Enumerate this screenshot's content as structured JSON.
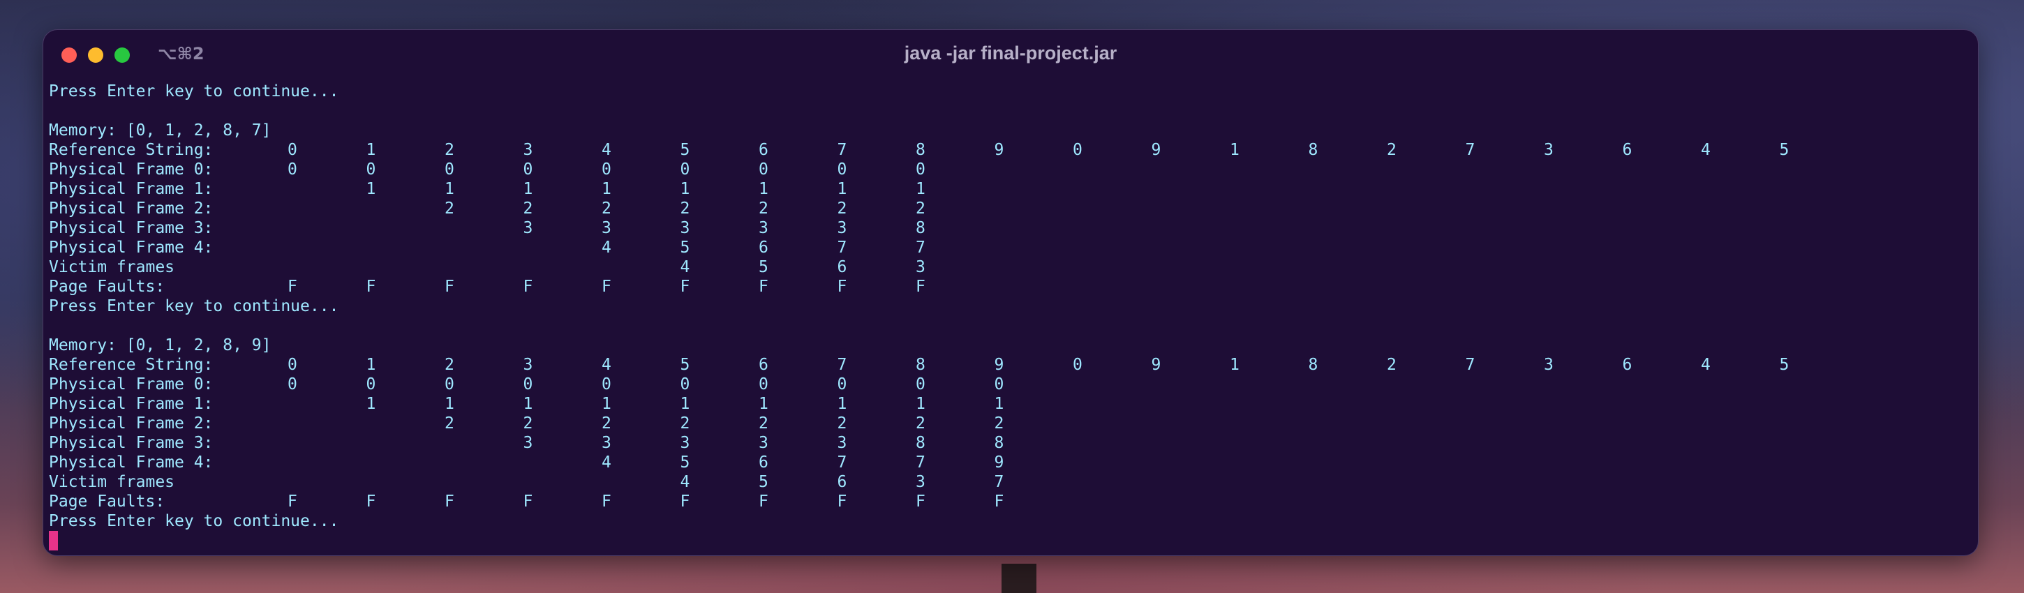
{
  "window": {
    "title": "java -jar final-project.jar",
    "shortcut": "⌥⌘2"
  },
  "colors": {
    "terminal_bg": "#1e0d36",
    "text": "#9fe8ff",
    "cursor": "#e6338a"
  },
  "terminal": {
    "lines": [
      "Press Enter key to continue...",
      "",
      "Memory: [0, 1, 2, 8, 7]",
      {
        "label": "Reference String:",
        "cells": [
          "0",
          "1",
          "2",
          "3",
          "4",
          "5",
          "6",
          "7",
          "8",
          "9",
          "0",
          "9",
          "1",
          "8",
          "2",
          "7",
          "3",
          "6",
          "4",
          "5"
        ]
      },
      {
        "label": "Physical Frame 0:",
        "cells": [
          "0",
          "0",
          "0",
          "0",
          "0",
          "0",
          "0",
          "0",
          "0"
        ]
      },
      {
        "label": "Physical Frame 1:",
        "cells": [
          "",
          "1",
          "1",
          "1",
          "1",
          "1",
          "1",
          "1",
          "1"
        ]
      },
      {
        "label": "Physical Frame 2:",
        "cells": [
          "",
          "",
          "2",
          "2",
          "2",
          "2",
          "2",
          "2",
          "2"
        ]
      },
      {
        "label": "Physical Frame 3:",
        "cells": [
          "",
          "",
          "",
          "3",
          "3",
          "3",
          "3",
          "3",
          "8"
        ]
      },
      {
        "label": "Physical Frame 4:",
        "cells": [
          "",
          "",
          "",
          "",
          "4",
          "5",
          "6",
          "7",
          "7"
        ]
      },
      {
        "label": "Victim frames",
        "cells": [
          "",
          "",
          "",
          "",
          "",
          "4",
          "5",
          "6",
          "3"
        ]
      },
      {
        "label": "Page Faults:",
        "cells": [
          "F",
          "F",
          "F",
          "F",
          "F",
          "F",
          "F",
          "F",
          "F"
        ]
      },
      "Press Enter key to continue...",
      "",
      "Memory: [0, 1, 2, 8, 9]",
      {
        "label": "Reference String:",
        "cells": [
          "0",
          "1",
          "2",
          "3",
          "4",
          "5",
          "6",
          "7",
          "8",
          "9",
          "0",
          "9",
          "1",
          "8",
          "2",
          "7",
          "3",
          "6",
          "4",
          "5"
        ]
      },
      {
        "label": "Physical Frame 0:",
        "cells": [
          "0",
          "0",
          "0",
          "0",
          "0",
          "0",
          "0",
          "0",
          "0",
          "0"
        ]
      },
      {
        "label": "Physical Frame 1:",
        "cells": [
          "",
          "1",
          "1",
          "1",
          "1",
          "1",
          "1",
          "1",
          "1",
          "1"
        ]
      },
      {
        "label": "Physical Frame 2:",
        "cells": [
          "",
          "",
          "2",
          "2",
          "2",
          "2",
          "2",
          "2",
          "2",
          "2"
        ]
      },
      {
        "label": "Physical Frame 3:",
        "cells": [
          "",
          "",
          "",
          "3",
          "3",
          "3",
          "3",
          "3",
          "8",
          "8"
        ]
      },
      {
        "label": "Physical Frame 4:",
        "cells": [
          "",
          "",
          "",
          "",
          "4",
          "5",
          "6",
          "7",
          "7",
          "9"
        ]
      },
      {
        "label": "Victim frames",
        "cells": [
          "",
          "",
          "",
          "",
          "",
          "4",
          "5",
          "6",
          "3",
          "7"
        ]
      },
      {
        "label": "Page Faults:",
        "cells": [
          "F",
          "F",
          "F",
          "F",
          "F",
          "F",
          "F",
          "F",
          "F",
          "F"
        ]
      },
      "Press Enter key to continue..."
    ]
  }
}
